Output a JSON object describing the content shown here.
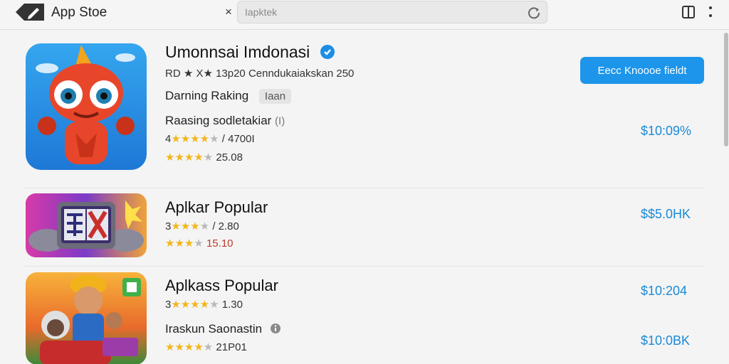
{
  "header": {
    "title": "App Stoe",
    "close_symbol": "×",
    "search_placeholder": "Iapktek",
    "icons": [
      "app-logo-icon",
      "close-icon",
      "refresh-icon",
      "book-icon",
      "more-icon"
    ]
  },
  "apps": [
    {
      "title": "Umonnsai Imdonasi",
      "subtitle": "RD ★ X★ 13p20  Cenndukaiakskan  250",
      "category": "Darning Raking",
      "tag": "Iaan",
      "button_label": "Eecc Knoooe fieldt",
      "sub_title": "Raasing sodletakiar",
      "sub_badge": "(I)",
      "rating_a": {
        "lead": "4",
        "stars": 4,
        "text": "/ 4700I"
      },
      "rating_b": {
        "stars": 4,
        "text": "25.08"
      },
      "price": "$10:09%"
    },
    {
      "title": "Aplkar Popular",
      "rating_a": {
        "lead": "3",
        "stars": 3,
        "text": "/ 2.80"
      },
      "rating_b": {
        "stars": 3,
        "text": "15.10"
      },
      "price": "$$5.0HK"
    },
    {
      "title": "Aplkass Popular",
      "rating_a": {
        "lead": "3",
        "stars": 4,
        "text": "1.30"
      },
      "sub_title": "Iraskun Saonastin",
      "rating_b": {
        "stars": 4,
        "text": "21P01"
      },
      "price_top": "$10:204",
      "price_bottom": "$10:0BK"
    }
  ],
  "colors": {
    "accent": "#1c95ea",
    "price": "#1a8ad6",
    "star": "#f3b51b"
  }
}
